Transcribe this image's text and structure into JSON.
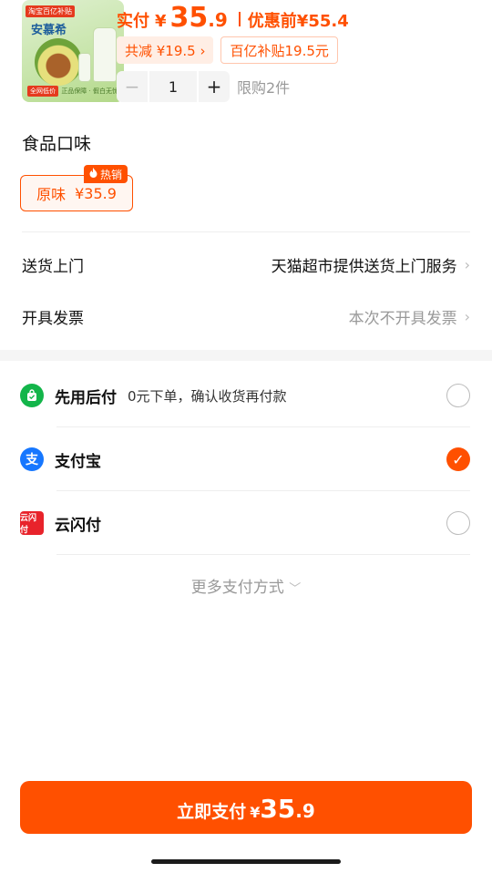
{
  "product": {
    "image_tag": "淘宝百亿补贴",
    "image_brand": "安慕希",
    "image_footer": "全网低价",
    "image_footer_right": "正品保障 · 假白无忧",
    "price_label": "实付",
    "currency": "¥",
    "price_int": "35",
    "price_dec": ".9",
    "original_label": "优惠前",
    "original_price": "¥55.4",
    "saving_chip": "共减 ¥19.5 ›",
    "subsidy_chip": "百亿补贴19.5元",
    "quantity": "1",
    "minus": "−",
    "plus": "+",
    "limit": "限购2件"
  },
  "flavor": {
    "title": "食品口味",
    "hot_badge": "热销",
    "option_name": "原味",
    "option_price": "¥35.9"
  },
  "delivery": {
    "label": "送货上门",
    "value": "天猫超市提供送货上门服务"
  },
  "invoice": {
    "label": "开具发票",
    "value": "本次不开具发票"
  },
  "payment": {
    "methods": [
      {
        "name": "先用后付",
        "desc": "0元下单，确认收货再付款",
        "icon": "bag-check-icon",
        "selected": false
      },
      {
        "name": "支付宝",
        "desc": "",
        "icon": "alipay-icon",
        "selected": true
      },
      {
        "name": "云闪付",
        "desc": "",
        "icon": "unionpay-icon",
        "selected": false
      }
    ],
    "more": "更多支付方式"
  },
  "cta": {
    "label": "立即支付",
    "currency": "¥",
    "int": "35",
    "dec": ".9"
  },
  "colors": {
    "accent": "#ff5000",
    "muted": "#999999"
  }
}
